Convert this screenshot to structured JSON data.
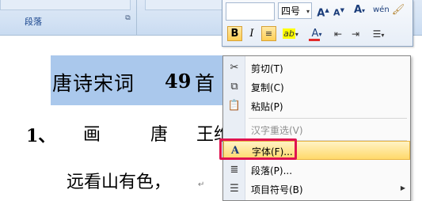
{
  "ribbon": {
    "paragraph_group_label": "段落",
    "launcher_icon": "dialog-launcher-icon"
  },
  "document": {
    "title_text": "唐诗宋词",
    "title_number": "49",
    "title_suffix": "首",
    "poem_number": "1、",
    "poem_title_1": "画",
    "poem_title_2": "唐",
    "poem_author": "王维",
    "line2": "远看山有色，",
    "paragraph_mark": "↵"
  },
  "mini_toolbar": {
    "font_size": "四号",
    "grow_font": "A",
    "shrink_font": "A",
    "font_style": "A",
    "pinyin_label": "wén",
    "bold": "B",
    "italic": "I",
    "center": "≡",
    "highlight": "ab",
    "font_color": "A",
    "dropdown_arrow": "▾",
    "highlight_color": "#ffff00",
    "font_color_value": "#e12a2a"
  },
  "context_menu": {
    "items": [
      {
        "label": "剪切(T)",
        "icon": "scissors-icon",
        "enabled": true
      },
      {
        "label": "复制(C)",
        "icon": "copy-icon",
        "enabled": true
      },
      {
        "label": "粘贴(P)",
        "icon": "paste-icon",
        "enabled": true
      },
      {
        "label": "汉字重选(V)",
        "icon": "",
        "enabled": false
      },
      {
        "label": "字体(F)...",
        "icon": "font-icon",
        "enabled": true,
        "hover": true
      },
      {
        "label": "段落(P)...",
        "icon": "paragraph-icon",
        "enabled": true
      },
      {
        "label": "项目符号(B)",
        "icon": "bullets-icon",
        "enabled": true,
        "submenu": true
      }
    ],
    "highlight_color": "#e0134f"
  }
}
